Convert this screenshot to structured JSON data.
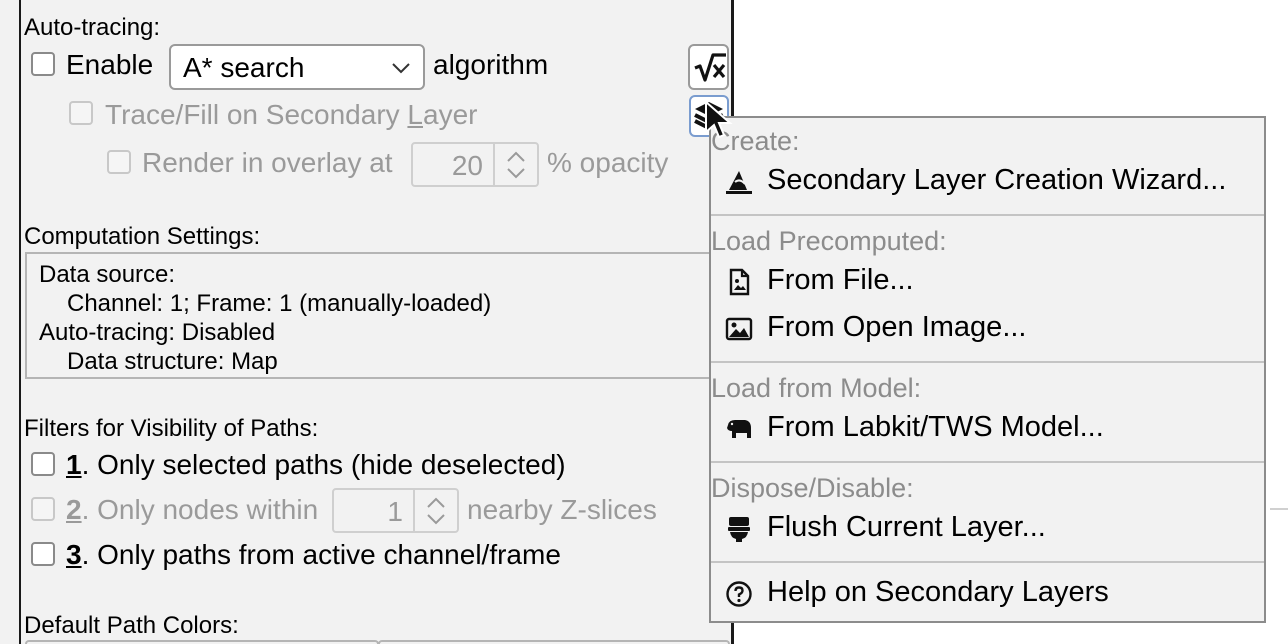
{
  "autotracing": {
    "section_label": "Auto-tracing:",
    "enable_label": "Enable",
    "algorithm_selected": "A* search",
    "algorithm_suffix": "algorithm",
    "secondary_layer_prefix": "Trace/Fill on Secondary ",
    "secondary_layer_mnemonic": "L",
    "secondary_layer_suffix": "ayer",
    "overlay_label": "Render in overlay at",
    "overlay_opacity": "20",
    "overlay_suffix": "% opacity"
  },
  "computation": {
    "section_label": "Computation Settings:",
    "lines": [
      "Data source:",
      "Channel: 1; Frame: 1 (manually-loaded)",
      "Auto-tracing: Disabled",
      "Data structure: Map"
    ]
  },
  "filters": {
    "section_label": "Filters for Visibility of Paths:",
    "f1_num": "1",
    "f1_text": ". Only selected paths (hide deselected)",
    "f2_num": "2",
    "f2_text": ". Only nodes within",
    "f2_value": "1",
    "f2_suffix": "nearby Z-slices",
    "f3_num": "3",
    "f3_text": ". Only paths from active channel/frame"
  },
  "colors": {
    "section_label": "Default Path Colors:"
  },
  "menu": {
    "create_header": "Create:",
    "wizard_label": "Secondary Layer Creation Wizard...",
    "load_precomputed_header": "Load Precomputed:",
    "from_file_label": "From File...",
    "from_open_image_label": "From Open Image...",
    "load_model_header": "Load from Model:",
    "from_labkit_label": "From Labkit/TWS Model...",
    "dispose_header": "Dispose/Disable:",
    "flush_label": "Flush Current Layer...",
    "help_label": "Help on Secondary Layers"
  },
  "icons": {
    "sqrt_button": "sqrt-icon",
    "layers_button": "layers-icon",
    "wizard": "wizard-hat-icon",
    "file": "file-image-icon",
    "image": "image-icon",
    "labkit": "tapir-icon",
    "flush": "toilet-icon",
    "help": "question-circle-icon",
    "cursor": "mouse-cursor-icon"
  }
}
